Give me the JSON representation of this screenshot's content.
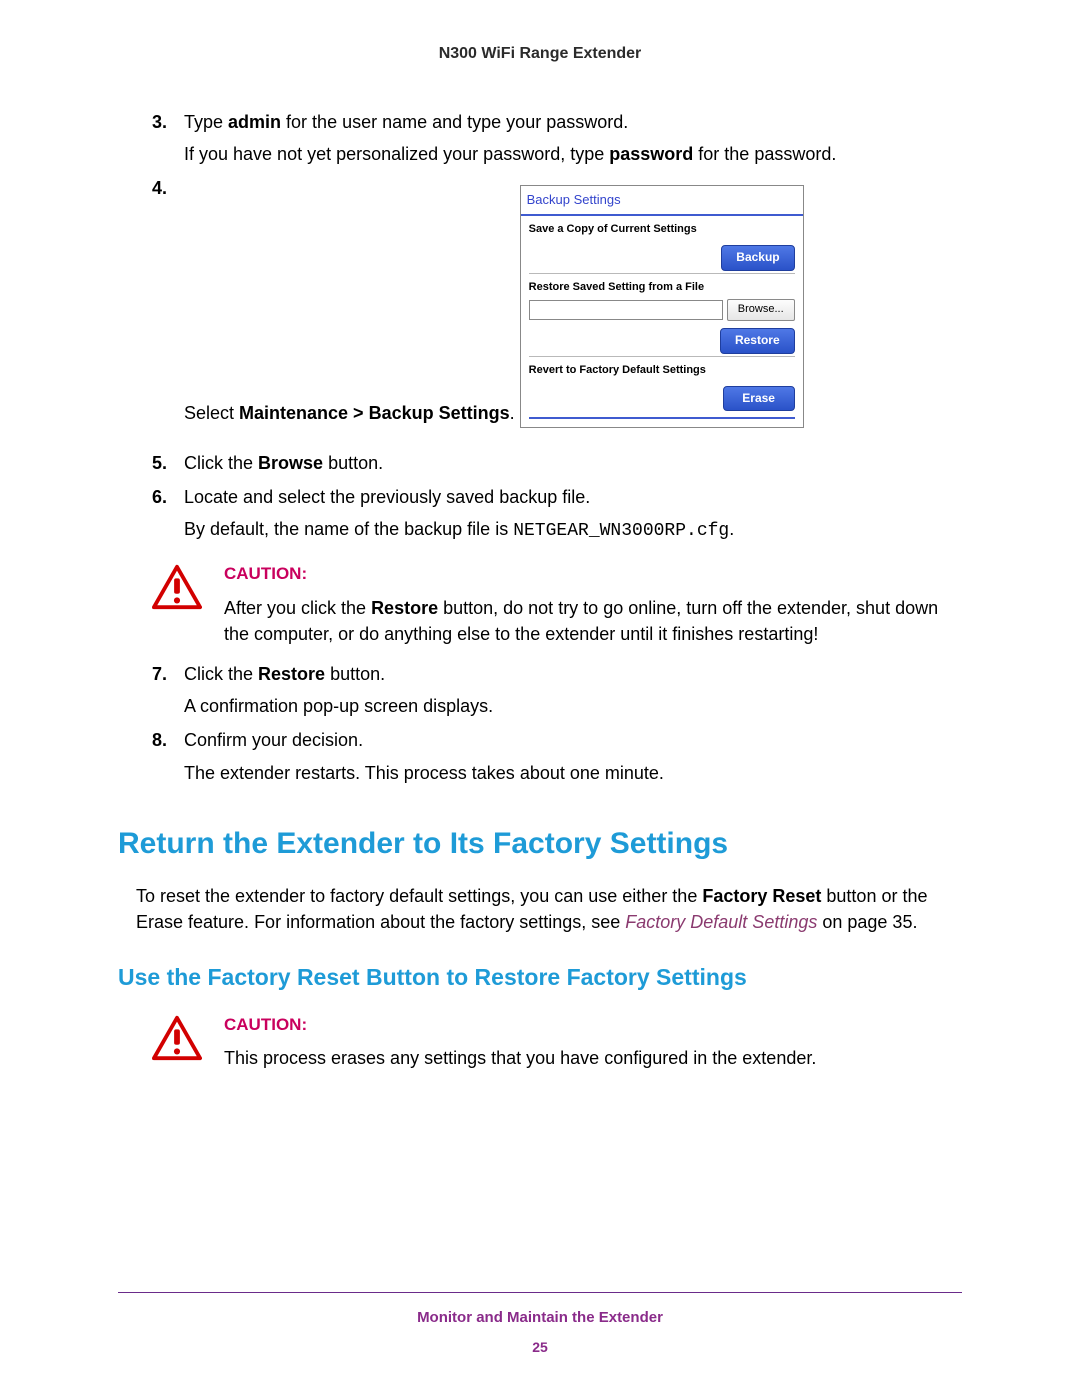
{
  "header": {
    "product": "N300 WiFi Range Extender"
  },
  "steps": {
    "s3": {
      "num": "3.",
      "text_a": "Type ",
      "text_b_bold": "admin",
      "text_c": " for the user name and type your password.",
      "sub_a": "If you have not yet personalized your password, type ",
      "sub_b_bold": "password",
      "sub_c": " for the password."
    },
    "s4": {
      "num": "4.",
      "text_a": "Select ",
      "text_b_bold": "Maintenance > Backup Settings",
      "text_c": "."
    },
    "s5": {
      "num": "5.",
      "text_a": "Click the ",
      "text_b_bold": "Browse",
      "text_c": " button."
    },
    "s6": {
      "num": "6.",
      "text": "Locate and select the previously saved backup file.",
      "sub_a": "By default, the name of the backup file is ",
      "sub_b_mono": "NETGEAR_WN3000RP.cfg",
      "sub_c": "."
    },
    "s7": {
      "num": "7.",
      "text_a": "Click the ",
      "text_b_bold": "Restore",
      "text_c": " button.",
      "sub": "A confirmation pop-up screen displays."
    },
    "s8": {
      "num": "8.",
      "text": "Confirm your decision.",
      "sub": "The extender restarts. This process takes about one minute."
    }
  },
  "figure": {
    "title": "Backup Settings",
    "sec1_label": "Save a Copy of Current Settings",
    "sec1_button": "Backup",
    "sec2_label": "Restore Saved Setting from a File",
    "sec2_browse": "Browse...",
    "sec2_button": "Restore",
    "sec3_label": "Revert to Factory Default Settings",
    "sec3_button": "Erase"
  },
  "caution1": {
    "label": "CAUTION:",
    "text_a": "After you click the ",
    "text_b_bold": "Restore",
    "text_c": " button, do not try to go online, turn off the extender, shut down the computer, or do anything else to the extender until it finishes restarting!"
  },
  "heading1": "Return the Extender to Its Factory Settings",
  "para1": {
    "a": "To reset the extender to factory default settings, you can use either the ",
    "b_bold": "Factory Reset",
    "c": " button or the Erase feature. For information about the factory settings, see ",
    "d_xref": "Factory Default Settings",
    "e": " on page 35."
  },
  "heading2": "Use the Factory Reset Button to Restore Factory Settings",
  "caution2": {
    "label": "CAUTION:",
    "text": "This process erases any settings that you have configured in the extender."
  },
  "footer": {
    "title": "Monitor and Maintain the Extender",
    "page": "25"
  }
}
